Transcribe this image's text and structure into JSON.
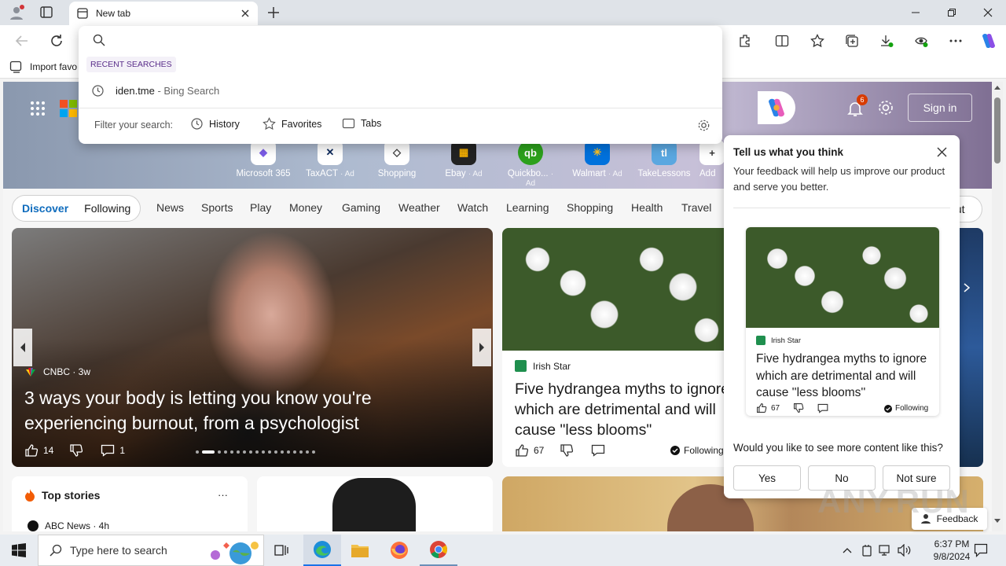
{
  "browser": {
    "tab_title": "New tab",
    "fav_import": "Import favo",
    "address_value": "",
    "recent_label": "RECENT SEARCHES",
    "recent_item": "iden.tme",
    "recent_suffix": " - Bing Search",
    "filter_label": "Filter your search:",
    "filter_history": "History",
    "filter_favorites": "Favorites",
    "filter_tabs": "Tabs",
    "notification_count": "6",
    "sign_in": "Sign in"
  },
  "apps": [
    {
      "name": "Microsoft 365",
      "ad": ""
    },
    {
      "name": "TaxACT",
      "ad": "· Ad"
    },
    {
      "name": "Shopping",
      "ad": ""
    },
    {
      "name": "Ebay",
      "ad": "· Ad"
    },
    {
      "name": "Quickbo...",
      "ad": "· Ad"
    },
    {
      "name": "Walmart",
      "ad": "· Ad"
    },
    {
      "name": "TakeLessons",
      "ad": ""
    },
    {
      "name": "Add",
      "ad": ""
    }
  ],
  "nav": {
    "discover": "Discover",
    "following": "Following",
    "items": [
      "News",
      "Sports",
      "Play",
      "Money",
      "Gaming",
      "Weather",
      "Watch",
      "Learning",
      "Shopping",
      "Health",
      "Travel"
    ],
    "layout_btn": "out"
  },
  "hero_card": {
    "source": "CNBC · 3w",
    "title": "3 ways your body is letting you know you're experiencing burnout, from a psychologist",
    "likes": "14",
    "comments": "1"
  },
  "hydrangea_card": {
    "source": "Irish Star",
    "title": "Five hydrangea myths to ignore which are detrimental and will cause \"less blooms\"",
    "likes": "67",
    "following": "Following"
  },
  "top_stories": {
    "title": "Top stories",
    "more": "···",
    "source": "ABC News · 4h"
  },
  "feedback": {
    "heading": "Tell us what you think",
    "text": "Your feedback will help us improve our product and serve you better.",
    "source": "Irish Star",
    "title": "Five hydrangea myths to ignore which are detrimental and will cause ''less blooms''",
    "likes": "67",
    "following": "Following",
    "question": "Would you like to see more content like this?",
    "yes": "Yes",
    "no": "No",
    "not_sure": "Not sure",
    "feedback_btn": "Feedback"
  },
  "taskbar": {
    "search_placeholder": "Type here to search",
    "time": "6:37 PM",
    "date": "9/8/2024"
  },
  "watermark": "ANY.RUN"
}
